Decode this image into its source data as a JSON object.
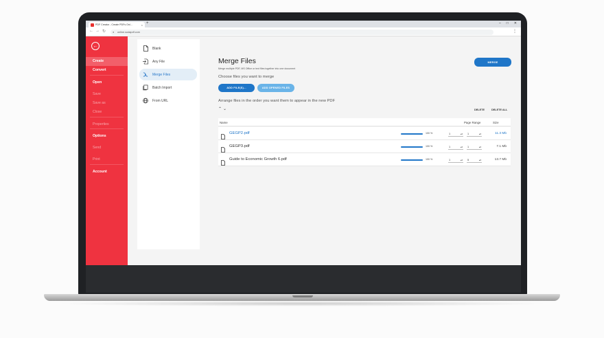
{
  "browser": {
    "tab_title": "PDF Creator - Create PDFs Onl...",
    "tab_close": "×",
    "new_tab": "+",
    "url": "online.sodapdf.com"
  },
  "sidebar": {
    "items": [
      {
        "label": "Create",
        "style": "bold",
        "active": true
      },
      {
        "label": "Convert",
        "style": "bold",
        "active": false
      },
      {
        "label": "Open",
        "style": "bold",
        "active": false
      },
      {
        "label": "Save",
        "style": "dim",
        "active": false
      },
      {
        "label": "Save as",
        "style": "dim",
        "active": false
      },
      {
        "label": "Close",
        "style": "dim",
        "active": false
      },
      {
        "label": "Properties",
        "style": "dim",
        "active": false
      },
      {
        "label": "Options",
        "style": "bold",
        "active": false
      },
      {
        "label": "Send",
        "style": "dim",
        "active": false
      },
      {
        "label": "Print",
        "style": "dim",
        "active": false
      },
      {
        "label": "Account",
        "style": "bold",
        "active": false
      }
    ]
  },
  "panel": {
    "items": [
      {
        "label": "Blank",
        "icon": "blank-document-icon"
      },
      {
        "label": "Any File",
        "icon": "import-file-icon"
      },
      {
        "label": "Merge Files",
        "icon": "merge-icon",
        "active": true
      },
      {
        "label": "Batch Import",
        "icon": "batch-import-icon"
      },
      {
        "label": "From URL",
        "icon": "globe-icon"
      }
    ]
  },
  "main": {
    "title": "Merge Files",
    "subtitle": "Merge multiple PDF, MS Office or text files together into one document",
    "choose_label": "Choose files you want to merge",
    "add_files_label": "ADD FILE(S)...",
    "add_opened_label": "ADD OPENED FILES",
    "merge_label": "MERGE",
    "arrange_label": "Arrange files in the order you want them to appear in the new PDF",
    "delete_label": "DELETE",
    "delete_all_label": "DELETE ALL",
    "columns": {
      "name": "Name",
      "page_range": "Page Range",
      "size": "Size"
    },
    "files": [
      {
        "name": "GEGP2.pdf",
        "progress": "100 %",
        "from": "1",
        "to": "1",
        "size": "11.3 Mb",
        "highlight": true
      },
      {
        "name": "GEGP3.pdf",
        "progress": "100 %",
        "from": "1",
        "to": "1",
        "size": "7.1 Mb",
        "highlight": false
      },
      {
        "name": "Guide to Economic Growth 6.pdf",
        "progress": "100 %",
        "from": "1",
        "to": "5",
        "size": "13.7 Mb",
        "highlight": false
      }
    ]
  },
  "colors": {
    "brand_red": "#ef3340",
    "accent_blue": "#1f76c8",
    "light_blue": "#6ab4e8"
  }
}
